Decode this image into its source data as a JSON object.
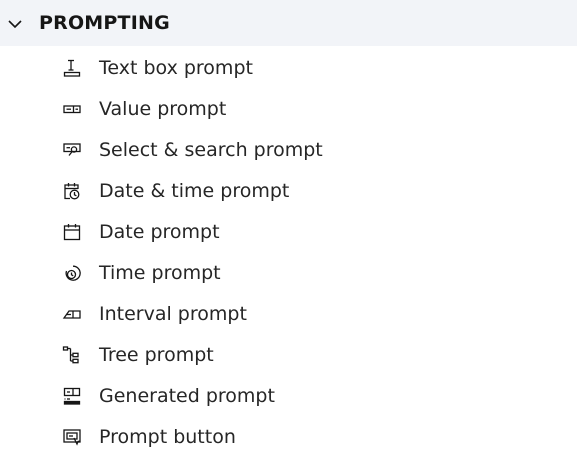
{
  "section": {
    "title": "PROMPTING",
    "expanded": true,
    "chevron_icon": "chevron-down-icon"
  },
  "items": [
    {
      "label": "Text box prompt",
      "icon": "text-box-prompt-icon"
    },
    {
      "label": "Value prompt",
      "icon": "value-prompt-icon"
    },
    {
      "label": "Select & search prompt",
      "icon": "select-search-prompt-icon"
    },
    {
      "label": "Date & time prompt",
      "icon": "date-time-prompt-icon"
    },
    {
      "label": "Date prompt",
      "icon": "date-prompt-icon"
    },
    {
      "label": "Time prompt",
      "icon": "time-prompt-icon"
    },
    {
      "label": "Interval prompt",
      "icon": "interval-prompt-icon"
    },
    {
      "label": "Tree prompt",
      "icon": "tree-prompt-icon"
    },
    {
      "label": "Generated prompt",
      "icon": "generated-prompt-icon"
    },
    {
      "label": "Prompt button",
      "icon": "prompt-button-icon"
    }
  ],
  "colors": {
    "header_background": "#f2f4f8",
    "text": "#161616",
    "icon": "#161616"
  }
}
